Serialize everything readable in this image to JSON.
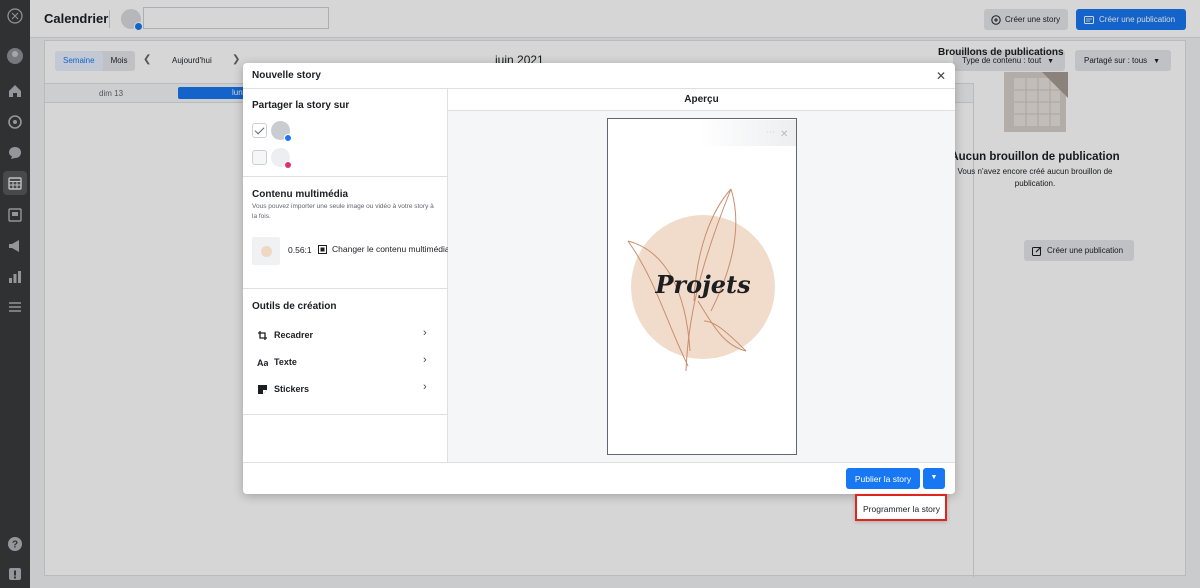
{
  "rail": {
    "icons": [
      "logo-icon",
      "avatar",
      "home-icon",
      "audience-icon",
      "inbox-icon",
      "calendar-icon",
      "content-icon",
      "ads-icon",
      "insights-icon",
      "menu-icon",
      "help-icon",
      "feedback-icon"
    ]
  },
  "header": {
    "title": "Calendrier",
    "create_story_label": "Créer une story",
    "create_post_label": "Créer une publication"
  },
  "calendar": {
    "view_week": "Semaine",
    "view_month": "Mois",
    "today_label": "Aujourd'hui",
    "month_label": "juin 2021",
    "filter_content": "Type de contenu : tout",
    "filter_shared": "Partagé sur : tous",
    "day_label": "dim 13",
    "day_highlight": "lun"
  },
  "drafts": {
    "title": "Brouillons de publications",
    "empty_heading": "Aucun brouillon de publication",
    "empty_text": "Vous n'avez encore créé aucun brouillon de publication.",
    "create_button": "Créer une publication"
  },
  "modal": {
    "title": "Nouvelle story",
    "share_heading": "Partager la story sur",
    "accounts": [
      {
        "platform": "facebook",
        "checked": true,
        "badge_color": "#1877f2"
      },
      {
        "platform": "instagram",
        "checked": false,
        "badge_color": "#e1306c"
      }
    ],
    "media_heading": "Contenu multimédia",
    "media_hint": "Vous pouvez importer une seule image ou vidéo à votre story à la fois.",
    "media_ratio": "0.56:1",
    "change_media": "Changer le contenu multimédia",
    "tools_heading": "Outils de création",
    "tools": [
      "Recadrer",
      "Texte",
      "Stickers"
    ],
    "preview_heading": "Aperçu",
    "preview_text": "Projets",
    "publish_button": "Publier la story",
    "schedule_option": "Programmer la story"
  },
  "colors": {
    "accent": "#1877f2",
    "highlight_box": "#e0241e",
    "disc": "#f1dccb"
  }
}
